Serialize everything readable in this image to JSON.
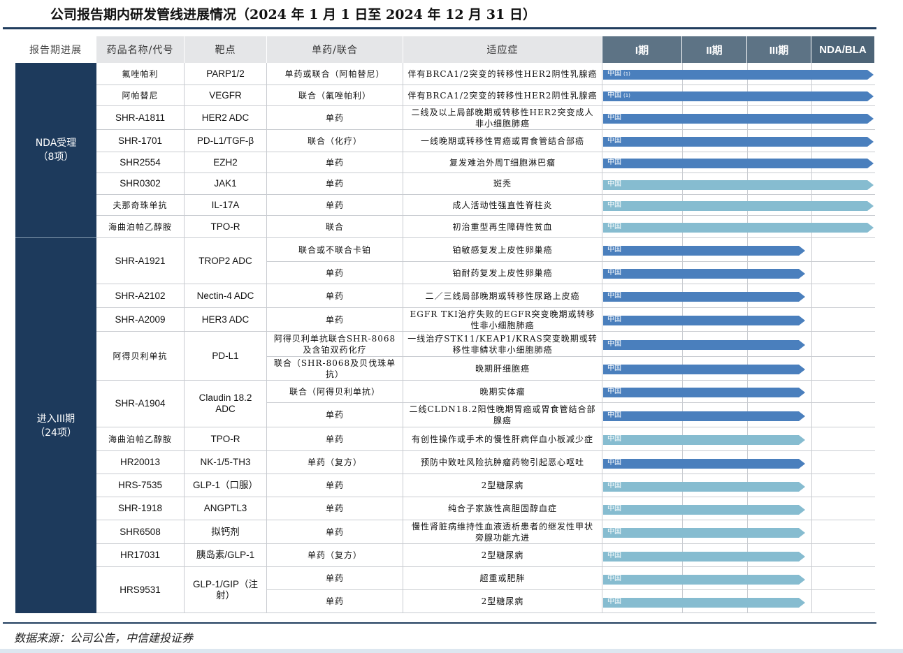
{
  "title": "公司报告期内研发管线进展情况（2024 年 1 月 1 日至 2024 年 12 月 31 日）",
  "headers": [
    "报告期进展",
    "药品名称/代号",
    "靶点",
    "单药/联合",
    "适应症",
    "I期",
    "II期",
    "III期",
    "NDA/BLA"
  ],
  "groups": [
    {
      "label": "NDA受理",
      "count": "（8项）"
    },
    {
      "label": "进入III期",
      "count": "（24项）"
    }
  ],
  "rows": [
    {
      "drug": "氟唑帕利",
      "target": "PARP1/2",
      "regimen": "单药或联合（阿帕替尼）",
      "indication": "伴有BRCA1/2突变的转移性HER2阴性乳腺癌",
      "bar": "中国",
      "note": "(1)"
    },
    {
      "drug": "阿帕替尼",
      "target": "VEGFR",
      "regimen": "联合（氟唑帕利）",
      "indication": "伴有BRCA1/2突变的转移性HER2阴性乳腺癌",
      "bar": "中国",
      "note": "(1)"
    },
    {
      "drug": "SHR-A1811",
      "target": "HER2 ADC",
      "regimen": "单药",
      "indication": "二线及以上局部晚期或转移性HER2突变成人非小细胞肺癌",
      "bar": "中国"
    },
    {
      "drug": "SHR-1701",
      "target": "PD-L1/TGF-β",
      "regimen": "联合（化疗）",
      "indication": "一线晚期或转移性胃癌或胃食管结合部癌",
      "bar": "中国"
    },
    {
      "drug": "SHR2554",
      "target": "EZH2",
      "regimen": "单药",
      "indication": "复发难治外周T细胞淋巴瘤",
      "bar": "中国"
    },
    {
      "drug": "SHR0302",
      "target": "JAK1",
      "regimen": "单药",
      "indication": "斑秃",
      "bar": "中国"
    },
    {
      "drug": "夫那奇珠单抗",
      "target": "IL-17A",
      "regimen": "单药",
      "indication": "成人活动性强直性脊柱炎",
      "bar": "中国"
    },
    {
      "drug": "海曲泊帕乙醇胺",
      "target": "TPO-R",
      "regimen": "联合",
      "indication": "初治重型再生障碍性贫血",
      "bar": "中国"
    },
    {
      "drug": "SHR-A1921",
      "target": "TROP2 ADC",
      "regimen": "联合或不联合卡铂",
      "indication": "铂敏感复发上皮性卵巢癌",
      "bar": "中国"
    },
    {
      "regimen": "单药",
      "indication": "铂耐药复发上皮性卵巢癌",
      "bar": "中国"
    },
    {
      "drug": "SHR-A2102",
      "target": "Nectin-4 ADC",
      "regimen": "单药",
      "indication": "二／三线局部晚期或转移性尿路上皮癌",
      "bar": "中国"
    },
    {
      "drug": "SHR-A2009",
      "target": "HER3 ADC",
      "regimen": "单药",
      "indication": "EGFR TKI治疗失败的EGFR突变晚期或转移性非小细胞肺癌",
      "bar": "中国"
    },
    {
      "drug": "阿得贝利单抗",
      "target": "PD-L1",
      "regimen": "阿得贝利单抗联合SHR-8068及含铂双药化疗",
      "indication": "一线治疗STK11/KEAP1/KRAS突变晚期或转移性非鳞状非小细胞肺癌",
      "bar": "中国"
    },
    {
      "regimen": "联合（SHR-8068及贝伐珠单抗）",
      "indication": "晚期肝细胞癌",
      "bar": "中国"
    },
    {
      "drug": "SHR-A1904",
      "target": "Claudin 18.2 ADC",
      "regimen": "联合（阿得贝利单抗）",
      "indication": "晚期实体瘤",
      "bar": "中国"
    },
    {
      "regimen": "单药",
      "indication": "二线CLDN18.2阳性晚期胃癌或胃食管结合部腺癌",
      "bar": "中国"
    },
    {
      "drug": "海曲泊帕乙醇胺",
      "target": "TPO-R",
      "regimen": "单药",
      "indication": "有创性操作或手术的慢性肝病伴血小板减少症",
      "bar": "中国"
    },
    {
      "drug": "HR20013",
      "target": "NK-1/5-TH3",
      "regimen": "单药（复方）",
      "indication": "预防中致吐风险抗肿瘤药物引起恶心呕吐",
      "bar": "中国"
    },
    {
      "drug": "HRS-7535",
      "target": "GLP-1（口服）",
      "regimen": "单药",
      "indication": "2型糖尿病",
      "bar": "中国"
    },
    {
      "drug": "SHR-1918",
      "target": "ANGPTL3",
      "regimen": "单药",
      "indication": "纯合子家族性高胆固醇血症",
      "bar": "中国"
    },
    {
      "drug": "SHR6508",
      "target": "拟钙剂",
      "regimen": "单药",
      "indication": "慢性肾脏病维持性血液透析患者的继发性甲状旁腺功能亢进",
      "bar": "中国"
    },
    {
      "drug": "HR17031",
      "target": "胰岛素/GLP-1",
      "regimen": "单药（复方）",
      "indication": "2型糖尿病",
      "bar": "中国"
    },
    {
      "drug": "HRS9531",
      "target": "GLP-1/GIP（注射）",
      "regimen": "单药",
      "indication": "超重或肥胖",
      "bar": "中国"
    },
    {
      "regimen": "单药",
      "indication": "2型糖尿病",
      "bar": "中国"
    }
  ],
  "colors": {
    "navy": "#1d3a5c",
    "bar_dark": "#4a7fbd",
    "bar_light": "#86bcd0",
    "header_gray": "#e5e6e8",
    "phase_header": "#5d7385"
  },
  "source": "数据来源：公司公告，中信建投证券"
}
